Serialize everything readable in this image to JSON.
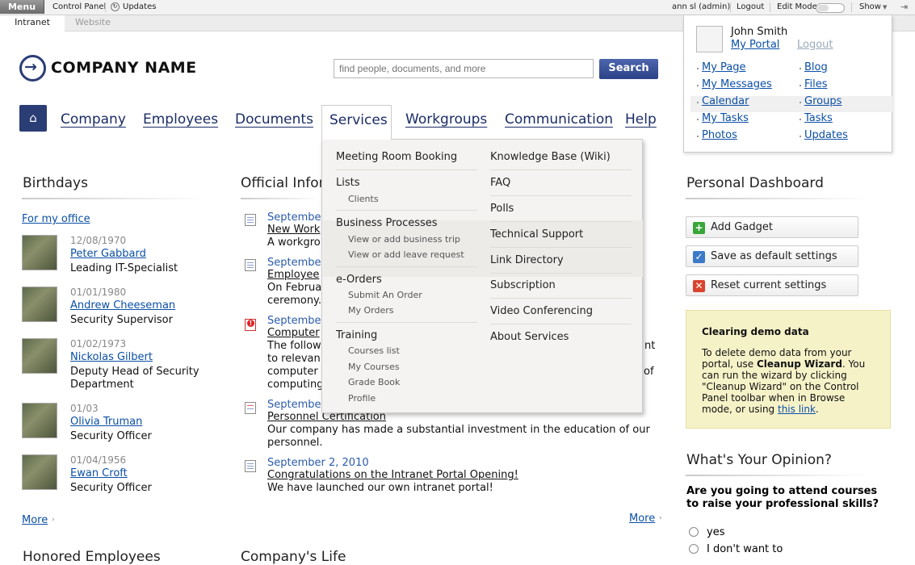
{
  "topbar": {
    "menu": "Menu",
    "control_panel": "Control Panel",
    "updates": "Updates",
    "user": "ann sl (admin)",
    "logout": "Logout",
    "edit_mode": "Edit Mode",
    "show": "Show"
  },
  "subbar": {
    "intranet": "Intranet",
    "website": "Website"
  },
  "header": {
    "company": "COMPANY NAME",
    "search_placeholder": "find people, documents, and more",
    "search_button": "Search"
  },
  "nav": {
    "company": "Company",
    "employees": "Employees",
    "documents": "Documents",
    "services": "Services",
    "workgroups": "Workgroups",
    "communication": "Communication",
    "help": "Help"
  },
  "dropdown": {
    "left": {
      "meeting": "Meeting Room Booking",
      "lists": "Lists",
      "clients": "Clients",
      "bp": "Business Processes",
      "trip": "View or add business trip",
      "leave": "View or add leave request",
      "eorders": "e-Orders",
      "submit": "Submit An Order",
      "myorders": "My Orders",
      "training": "Training",
      "courses": "Courses list",
      "mycourses": "My Courses",
      "grade": "Grade Book",
      "profile": "Profile"
    },
    "right": {
      "kb": "Knowledge Base (Wiki)",
      "faq": "FAQ",
      "polls": "Polls",
      "tech": "Technical Support",
      "linkdir": "Link Directory",
      "subscription": "Subscription",
      "video": "Video Conferencing",
      "about": "About Services"
    }
  },
  "birthdays": {
    "title": "Birthdays",
    "office": "For my office",
    "more": "More",
    "people": [
      {
        "date": "12/08/1970",
        "name": "Peter Gabbard",
        "role": "Leading IT-Specialist"
      },
      {
        "date": "01/01/1980",
        "name": "Andrew Cheeseman",
        "role": "Security Supervisor"
      },
      {
        "date": "01/02/1973",
        "name": "Nickolas Gilbert",
        "role": "Deputy Head of Security Department"
      },
      {
        "date": "01/03",
        "name": "Olivia Truman",
        "role": "Security Officer"
      },
      {
        "date": "01/04/1956",
        "name": "Ewan Croft",
        "role": "Security Officer"
      }
    ]
  },
  "official": {
    "title": "Official Inform",
    "more": "More",
    "items": [
      {
        "date": "September",
        "title": "New Work",
        "text": "A workgro"
      },
      {
        "date": "September",
        "title": "Employee",
        "text1": "On Februa",
        "text2": "ceremony."
      },
      {
        "date": "September",
        "title": "Computer",
        "t1": "The follow",
        "t1r": "nt",
        "t2": "to relevan",
        "t3": "computer",
        "t3r": "of",
        "t4": "computing"
      },
      {
        "date": "September",
        "title": "Personnel Certification",
        "text": "Our company has made a substantial investment in the education of our personnel."
      },
      {
        "date": "September 2, 2010",
        "title": "Congratulations on the Intranet Portal Opening!",
        "text": "We have launched our own intranet portal!"
      }
    ]
  },
  "bottom": {
    "honored": "Honored Employees",
    "life": "Company's Life"
  },
  "user_panel": {
    "name": "John Smith",
    "portal": "My Portal",
    "logout": "Logout",
    "left_links": [
      "My Page",
      "My Messages",
      "Calendar",
      "My Tasks",
      "Photos"
    ],
    "right_links": [
      "Blog",
      "Files",
      "Groups",
      "Tasks",
      "Updates"
    ]
  },
  "dashboard": {
    "title": "Personal Dashboard",
    "add": "Add Gadget",
    "save": "Save as default settings",
    "reset": "Reset current settings"
  },
  "demo": {
    "title": "Clearing demo data",
    "l1": "To delete demo data from your",
    "l2a": "portal, use ",
    "l2b": "Cleanup Wizard",
    "l2c": ". You",
    "l3": "can run the wizard by clicking",
    "l4": "\"Cleanup Wizard\" on the Control",
    "l5": "Panel toolbar when in Browse",
    "l6": "mode, or using ",
    "link": "this link",
    "l6end": "."
  },
  "opinion": {
    "title": "What's Your Opinion?",
    "q1": "Are you going to attend courses",
    "q2": "to raise your professional skills?",
    "yes": "yes",
    "no": "I don't want to"
  },
  "colors": {
    "brand": "#2b3d75",
    "link": "#0b4fa6",
    "accent_yellow": "#f6f2c8"
  }
}
